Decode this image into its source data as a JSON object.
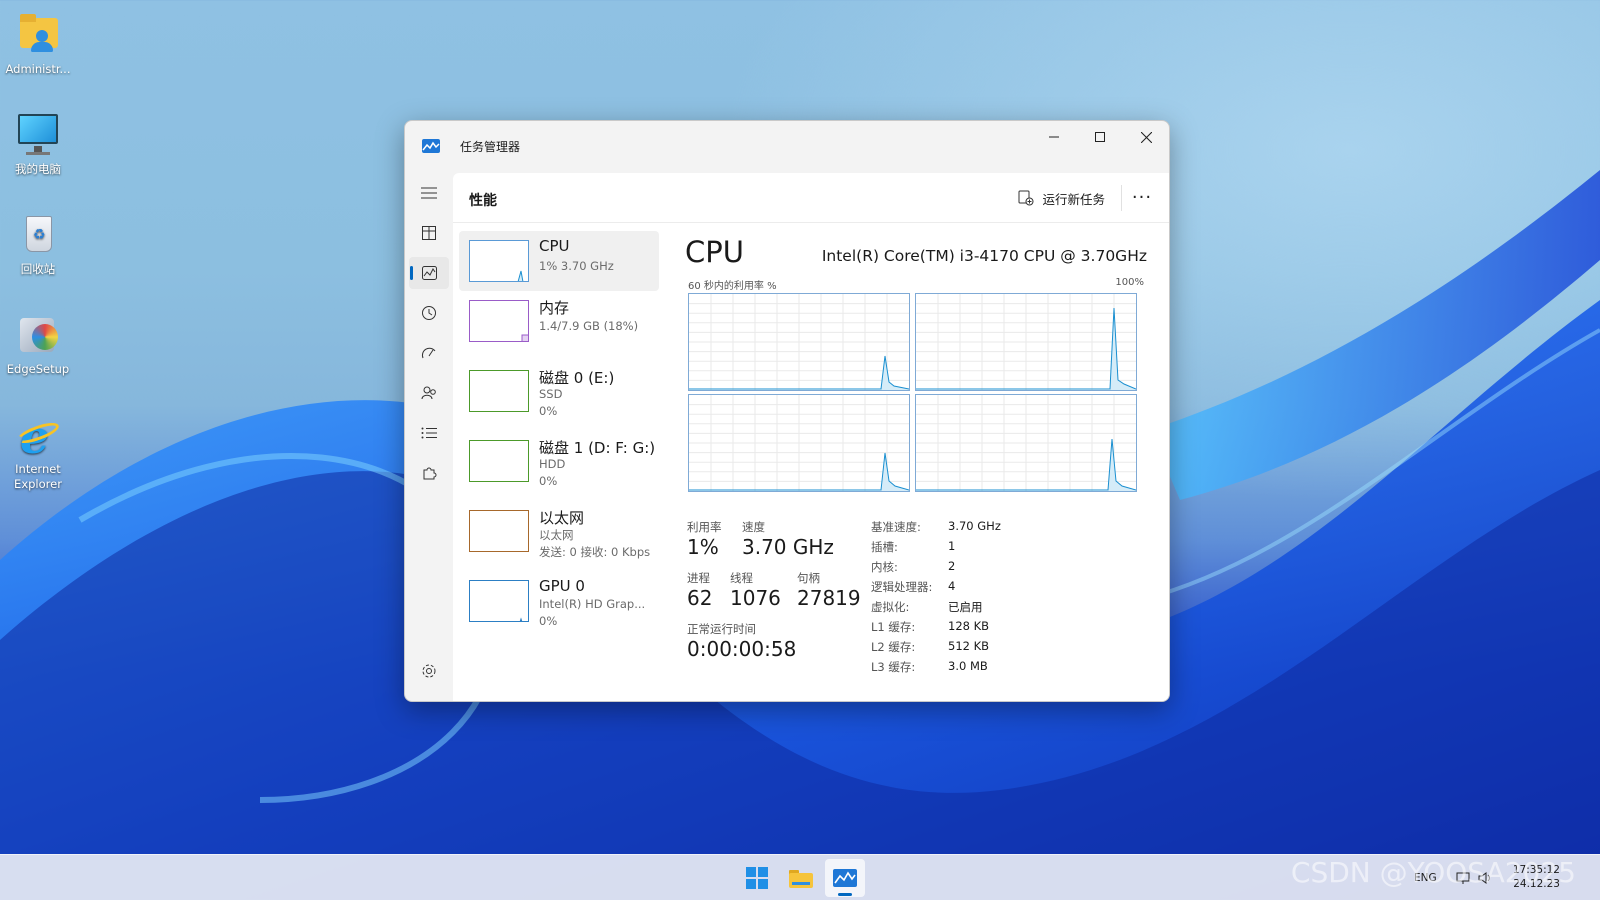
{
  "desktop": {
    "icons": [
      {
        "label": "Administr...",
        "icon": "user-folder-icon"
      },
      {
        "label": "我的电脑",
        "icon": "monitor-icon"
      },
      {
        "label": "回收站",
        "icon": "recycle-bin-icon"
      },
      {
        "label": "EdgeSetup",
        "icon": "installer-icon"
      },
      {
        "label": "Internet Explorer",
        "icon": "ie-icon"
      }
    ]
  },
  "window": {
    "title": "任务管理器",
    "header": {
      "page_title": "性能",
      "run_task_label": "运行新任务",
      "more_label": "···"
    },
    "resources": [
      {
        "name": "CPU",
        "sub1": "1% 3.70 GHz",
        "sub2": ""
      },
      {
        "name": "内存",
        "sub1": "1.4/7.9 GB (18%)",
        "sub2": ""
      },
      {
        "name": "磁盘 0 (E:)",
        "sub1": "SSD",
        "sub2": "0%"
      },
      {
        "name": "磁盘 1 (D: F: G:)",
        "sub1": "HDD",
        "sub2": "0%"
      },
      {
        "name": "以太网",
        "sub1": "以太网",
        "sub2": "发送: 0 接收: 0 Kbps"
      },
      {
        "name": "GPU 0",
        "sub1": "Intel(R) HD Grap...",
        "sub2": "0%"
      }
    ],
    "detail": {
      "title": "CPU",
      "model": "Intel(R) Core(TM) i3-4170 CPU @ 3.70GHz",
      "graph_label": "60 秒内的利用率 %",
      "graph_max": "100%",
      "stats": {
        "util_label": "利用率",
        "util_value": "1%",
        "speed_label": "速度",
        "speed_value": "3.70 GHz",
        "proc_label": "进程",
        "proc_value": "62",
        "thread_label": "线程",
        "thread_value": "1076",
        "handle_label": "句柄",
        "handle_value": "27819",
        "uptime_label": "正常运行时间",
        "uptime_value": "0:00:00:58"
      },
      "specs": [
        {
          "k": "基准速度:",
          "v": "3.70 GHz"
        },
        {
          "k": "插槽:",
          "v": "1"
        },
        {
          "k": "内核:",
          "v": "2"
        },
        {
          "k": "逻辑处理器:",
          "v": "4"
        },
        {
          "k": "虚拟化:",
          "v": "已启用"
        },
        {
          "k": "L1 缓存:",
          "v": "128 KB"
        },
        {
          "k": "L2 缓存:",
          "v": "512 KB"
        },
        {
          "k": "L3 缓存:",
          "v": "3.0 MB"
        }
      ]
    }
  },
  "taskbar": {
    "lang": "ENG",
    "time": "17:35:12",
    "date": "24.12.23"
  },
  "watermark": "CSDN @YOOSA2025",
  "colors": {
    "accent": "#0067c0",
    "graph_line": "#1a8fd0",
    "graph_fill": "#d5ecf8"
  }
}
